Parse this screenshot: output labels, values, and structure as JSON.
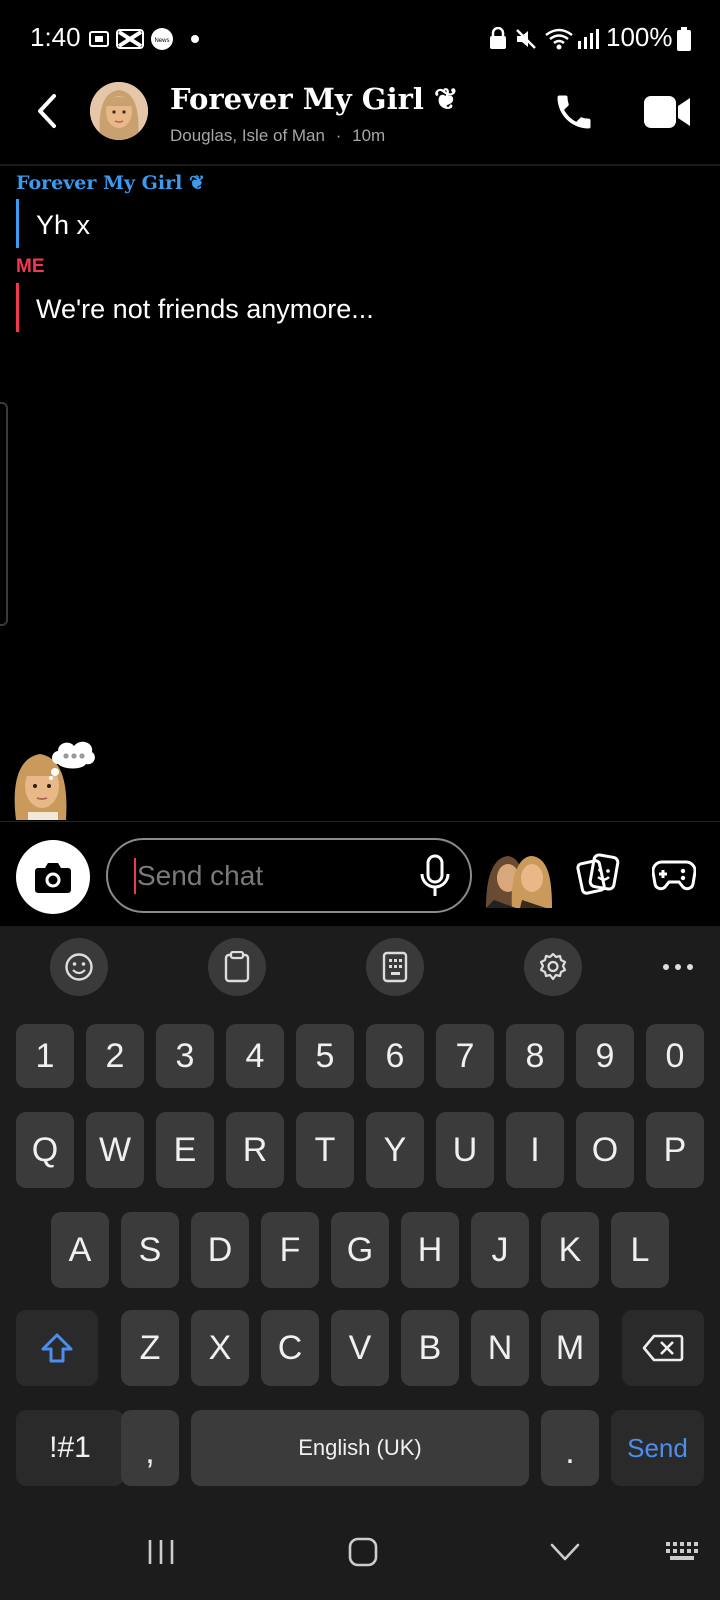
{
  "status_bar": {
    "time": "1:40",
    "battery": "100%",
    "left_icons": [
      "screen-record-icon",
      "capcut-icon",
      "news-icon",
      "dot-icon"
    ],
    "right_icons": [
      "lock-icon",
      "mute-icon",
      "wifi-icon",
      "signal-icon",
      "battery-icon"
    ]
  },
  "header": {
    "name": "Forever My Girl",
    "heart_glyph": "❦",
    "location": "Douglas, Isle of Man",
    "separator": "·",
    "last_seen": "10m"
  },
  "messages": [
    {
      "sender": "Forever My Girl ❦",
      "text": "Yh x",
      "color": "#3b9bf1"
    },
    {
      "sender": "ME",
      "text": "We're not friends anymore...",
      "color": "#f0394f"
    }
  ],
  "input": {
    "placeholder": "Send chat"
  },
  "keyboard": {
    "toolbar": [
      "emoji-icon",
      "clipboard-icon",
      "keypad-icon",
      "settings-icon",
      "more-icon"
    ],
    "row_numbers": [
      "1",
      "2",
      "3",
      "4",
      "5",
      "6",
      "7",
      "8",
      "9",
      "0"
    ],
    "row1": [
      "Q",
      "W",
      "E",
      "R",
      "T",
      "Y",
      "U",
      "I",
      "O",
      "P"
    ],
    "row2": [
      "A",
      "S",
      "D",
      "F",
      "G",
      "H",
      "J",
      "K",
      "L"
    ],
    "row3": [
      "Z",
      "X",
      "C",
      "V",
      "B",
      "N",
      "M"
    ],
    "symbols_label": "!#1",
    "comma_label": ",",
    "space_label": "English (UK)",
    "period_label": ".",
    "send_label": "Send"
  },
  "colors": {
    "accent_blue": "#3b9bf1",
    "accent_red": "#f0394f",
    "send_blue": "#4c8ef0"
  }
}
